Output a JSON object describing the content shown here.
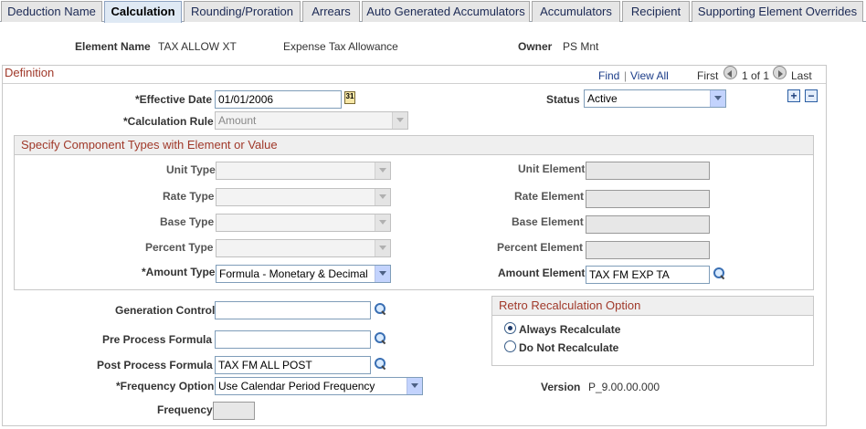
{
  "tabs": [
    {
      "label": "Deduction Name",
      "active": false
    },
    {
      "label": "Calculation",
      "active": true
    },
    {
      "label": "Rounding/Proration",
      "active": false
    },
    {
      "label": "Arrears",
      "active": false
    },
    {
      "label": "Auto Generated Accumulators",
      "active": false
    },
    {
      "label": "Accumulators",
      "active": false
    },
    {
      "label": "Recipient",
      "active": false
    },
    {
      "label": "Supporting Element Overrides",
      "active": false
    }
  ],
  "header": {
    "element_name_label": "Element Name",
    "element_name_value": "TAX ALLOW XT",
    "description": "Expense Tax Allowance",
    "owner_label": "Owner",
    "owner_value": "PS Mnt"
  },
  "definition": {
    "title": "Definition",
    "find_link": "Find",
    "separator": "|",
    "view_all_link": "View All",
    "first_label": "First",
    "page_counter": "1 of 1",
    "last_label": "Last",
    "effective_date_label": "*Effective Date",
    "effective_date_value": "01/01/2006",
    "calendar_icon_text": "31",
    "status_label": "Status",
    "status_value": "Active",
    "add_row_symbol": "+",
    "delete_row_symbol": "−",
    "calculation_rule_label": "*Calculation Rule",
    "calculation_rule_value": "Amount"
  },
  "components": {
    "title": "Specify Component Types with Element or Value",
    "unit_type_label": "Unit Type",
    "unit_type_value": "",
    "unit_element_label": "Unit Element",
    "unit_element_value": "",
    "rate_type_label": "Rate Type",
    "rate_type_value": "",
    "rate_element_label": "Rate Element",
    "rate_element_value": "",
    "base_type_label": "Base Type",
    "base_type_value": "",
    "base_element_label": "Base Element",
    "base_element_value": "",
    "percent_type_label": "Percent Type",
    "percent_type_value": "",
    "percent_element_label": "Percent Element",
    "percent_element_value": "",
    "amount_type_label": "*Amount Type",
    "amount_type_value": "Formula - Monetary & Decimal",
    "amount_element_label": "Amount Element",
    "amount_element_value": "TAX FM EXP TA"
  },
  "processing": {
    "generation_control_label": "Generation Control",
    "generation_control_value": "",
    "pre_process_label": "Pre Process Formula",
    "pre_process_value": "",
    "post_process_label": "Post Process Formula",
    "post_process_value": "TAX FM ALL POST",
    "frequency_option_label": "*Frequency Option",
    "frequency_option_value": "Use Calendar Period Frequency",
    "frequency_label": "Frequency",
    "frequency_value": "",
    "version_label": "Version",
    "version_value": "P_9.00.00.000"
  },
  "retro": {
    "title": "Retro Recalculation Option",
    "always_label": "Always Recalculate",
    "always_selected": true,
    "never_label": "Do Not Recalculate",
    "never_selected": false
  }
}
